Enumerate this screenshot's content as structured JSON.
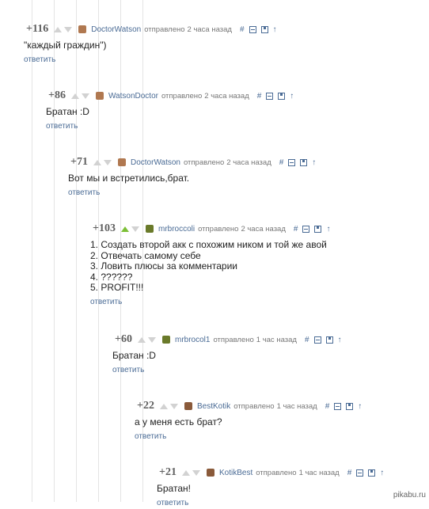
{
  "ui": {
    "posted_word": "отправлено",
    "reply_label": "ответить",
    "link_icon": "hash-icon",
    "up_icon": "arrow-up-icon"
  },
  "comments": [
    {
      "rating": "+116",
      "author": "DoctorWatson",
      "time": "2 часа назад",
      "text": "\"каждый граждин\")",
      "avatar_color": "#b07850",
      "upvoted": false
    },
    {
      "rating": "+86",
      "author": "WatsonDoctor",
      "time": "2 часа назад",
      "text": "Братан :D",
      "avatar_color": "#b07850",
      "upvoted": false
    },
    {
      "rating": "+71",
      "author": "DoctorWatson",
      "time": "2 часа назад",
      "text": "Вот мы и встретились,брат.",
      "avatar_color": "#b07850",
      "upvoted": false
    },
    {
      "rating": "+103",
      "author": "mrbroccoli",
      "time": "2 часа назад",
      "text": "1. Создать второй акк с похожим ником и той же авой\n2. Отвечать самому себе\n3. Ловить плюсы за комментарии\n4. ??????\n5. PROFIT!!!",
      "avatar_color": "#6a7a2a",
      "upvoted": true
    },
    {
      "rating": "+60",
      "author": "mrbrocol1",
      "time": "1 час назад",
      "text": "Братан :D",
      "avatar_color": "#6a7a2a",
      "upvoted": false
    },
    {
      "rating": "+22",
      "author": "BestKotik",
      "time": "1 час назад",
      "text": "а у меня есть брат?",
      "avatar_color": "#8a5a3a",
      "upvoted": false
    },
    {
      "rating": "+21",
      "author": "KotikBest",
      "time": "1 час назад",
      "text": "Братан!",
      "avatar_color": "#8a5a3a",
      "upvoted": false
    }
  ],
  "watermark": "pikabu.ru"
}
